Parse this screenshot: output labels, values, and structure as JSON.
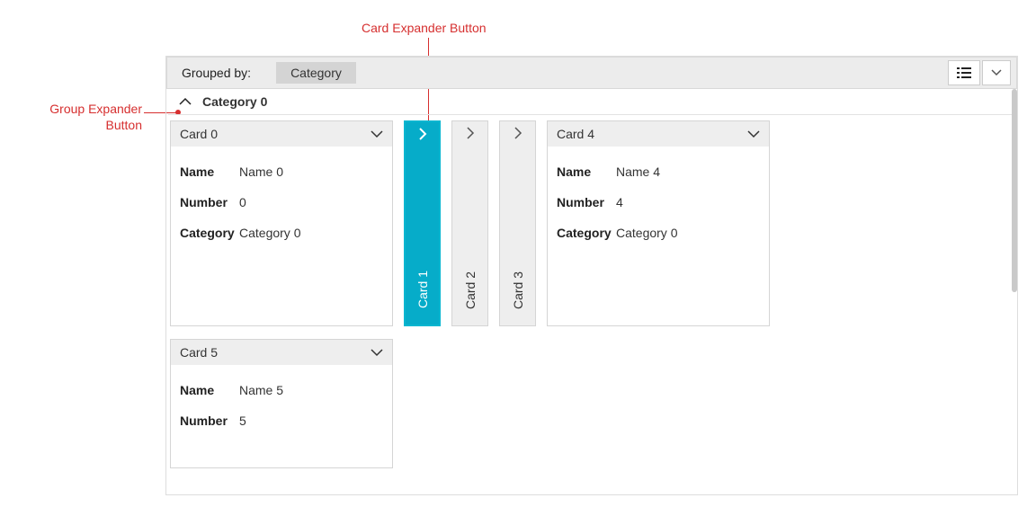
{
  "annotations": {
    "groupExpander": "Group Expander\nButton",
    "cardExpander": "Card Expander Button"
  },
  "toolbar": {
    "grouped_by_label": "Grouped by:",
    "group_field": "Category"
  },
  "group": {
    "title": "Category 0"
  },
  "cards": {
    "c0": {
      "title": "Card 0",
      "fields": {
        "name_label": "Name",
        "name_value": "Name 0",
        "number_label": "Number",
        "number_value": "0",
        "category_label": "Category",
        "category_value": "Category 0"
      }
    },
    "c1": {
      "title": "Card 1"
    },
    "c2": {
      "title": "Card 2"
    },
    "c3": {
      "title": "Card 3"
    },
    "c4": {
      "title": "Card 4",
      "fields": {
        "name_label": "Name",
        "name_value": "Name 4",
        "number_label": "Number",
        "number_value": "4",
        "category_label": "Category",
        "category_value": "Category 0"
      }
    },
    "c5": {
      "title": "Card 5",
      "fields": {
        "name_label": "Name",
        "name_value": "Name 5",
        "number_label": "Number",
        "number_value": "5"
      }
    }
  }
}
